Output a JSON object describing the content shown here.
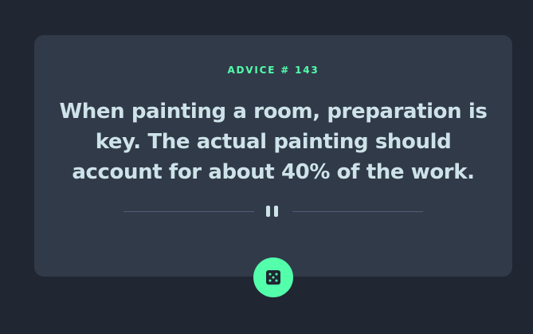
{
  "advice": {
    "id_label": "ADVICE # 143",
    "text": "When painting a room, preparation is key. The actual painting should account for about 40% of the work."
  },
  "divider": {
    "icon": "pause-icon"
  },
  "dice_button": {
    "icon": "dice-icon"
  },
  "colors": {
    "background": "#202632",
    "card": "#313a49",
    "accent": "#53ffab",
    "text": "#cee3e9",
    "divider": "#4f5d74"
  }
}
